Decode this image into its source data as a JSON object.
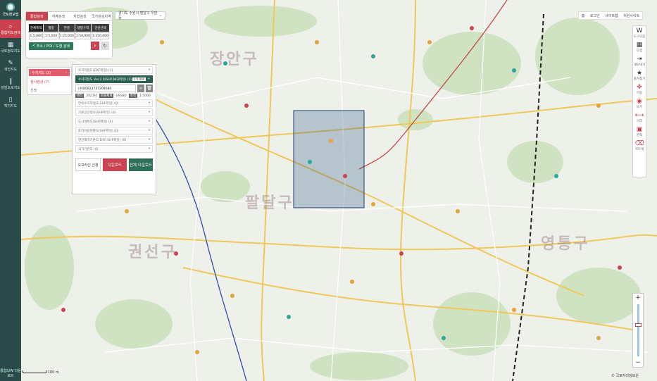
{
  "rail": {
    "logo_label": "국토정보맵",
    "items": [
      {
        "label": "통합지도검색",
        "icon": "map-search-icon",
        "active": true
      },
      {
        "label": "국토정보지도",
        "icon": "layers-icon"
      },
      {
        "label": "색인지도",
        "icon": "pen-icon"
      },
      {
        "label": "정밀도로지도",
        "icon": "road-icon"
      },
      {
        "label": "백지지도",
        "icon": "document-icon"
      }
    ],
    "bottom_label": "통합S/W 다운로드"
  },
  "search": {
    "tabs": [
      "통합검색",
      "지역검색",
      "지형검색",
      "국가관심지역"
    ],
    "scales_top": [
      "전체축척",
      "행정",
      "연결",
      "행정구역",
      "건반선택"
    ],
    "scales_bottom": [
      "1:5,000",
      "1:5,000",
      "1:25,000",
      "1:50,000",
      "1:250,000"
    ],
    "address_button": "주소 / POI / 도엽 검색"
  },
  "location": {
    "text": "경기도 수원시 팔달구 우만동"
  },
  "topright": [
    "홈",
    "로그인",
    "사이트맵",
    "위원사이트"
  ],
  "right_toolbar": [
    {
      "label": "도구모음",
      "icon": "w-icon"
    },
    {
      "label": "도엽",
      "icon": "grid-icon"
    },
    {
      "label": "내보내기",
      "icon": "export-icon"
    },
    {
      "label": "즐겨찾기",
      "icon": "star-icon"
    },
    {
      "label": "이동",
      "icon": "move-icon"
    },
    {
      "label": "보기",
      "icon": "eye-icon"
    },
    {
      "label": "거리",
      "icon": "ruler-icon"
    },
    {
      "label": "면적",
      "icon": "area-icon"
    },
    {
      "label": "지우개",
      "icon": "eraser-icon"
    }
  ],
  "layers_menu": {
    "items": [
      "수치지도 (2)",
      "정사영상 (7)",
      "선명"
    ]
  },
  "layer_detail": {
    "top_item": "수치지형도(DXF파일) (1)",
    "selected": "수치지형도 Ver.2.0(SHP,NGI파일) (1)",
    "selected_pill": "1:5,000",
    "path": "(수원0823737209080",
    "meta": [
      "제작",
      "2021년",
      "좌표체계",
      "GRS80",
      "축척",
      "1:5000"
    ],
    "rest": [
      "연속수치지형도(SHP파일) (0)",
      "기본공간정보(SHP파일) (0)",
      "도시계획도(SHP파일) (0)",
      "토지이용현황도(SHP파일) (0)",
      "연안해역기본도(DXF,SHP파일) (0)",
      "국가기본도 (0)"
    ],
    "buttons": [
      "오프라인 신청",
      "다운로드",
      "전체 다운로드"
    ]
  },
  "map": {
    "districts": [
      "장안구",
      "팔달구",
      "권선구",
      "영통구"
    ],
    "scalebar": "100 m",
    "copyright": "© 국토지리정보원"
  }
}
